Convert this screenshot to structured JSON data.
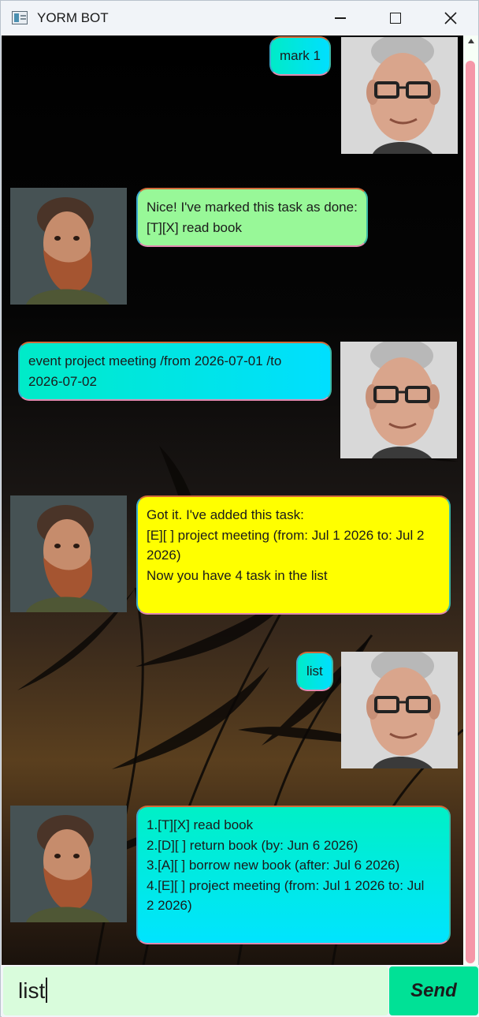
{
  "window": {
    "title": "YORM BOT",
    "icon": "app-window-icon",
    "controls": [
      "minimize-icon",
      "maximize-icon",
      "close-icon"
    ]
  },
  "messages": [
    {
      "sender": "user",
      "text": "mark 1"
    },
    {
      "sender": "bot",
      "text": "Nice! I've marked this task as done:\n[T][X] read book"
    },
    {
      "sender": "user",
      "text": "event project meeting /from 2026-07-01 /to\n2026-07-02"
    },
    {
      "sender": "bot",
      "text": "Got it. I've added this task:\n[E][ ] project meeting (from: Jul 1 2026 to: Jul 2\n2026)\nNow you have 4 task in the list"
    },
    {
      "sender": "user",
      "text": "list"
    },
    {
      "sender": "bot",
      "text": "1.[T][X] read book\n2.[D][ ] return book (by: Jun 6 2026)\n3.[A][ ] borrow new book (after: Jul 6 2026)\n4.[E][ ] project meeting (from: Jul 1 2026 to: Jul\n2 2026)"
    }
  ],
  "colors": {
    "user_bubble": "#00e5e0",
    "bot_bubble_1": "#98f898",
    "bot_bubble_2": "#ffff00",
    "bot_bubble_3": "#00eae0",
    "input_bg": "#d9fcdc",
    "send_bg": "#00e196",
    "scroll_thumb": "#f597a8"
  },
  "input": {
    "value": "list"
  },
  "send_button": {
    "label": "Send"
  }
}
